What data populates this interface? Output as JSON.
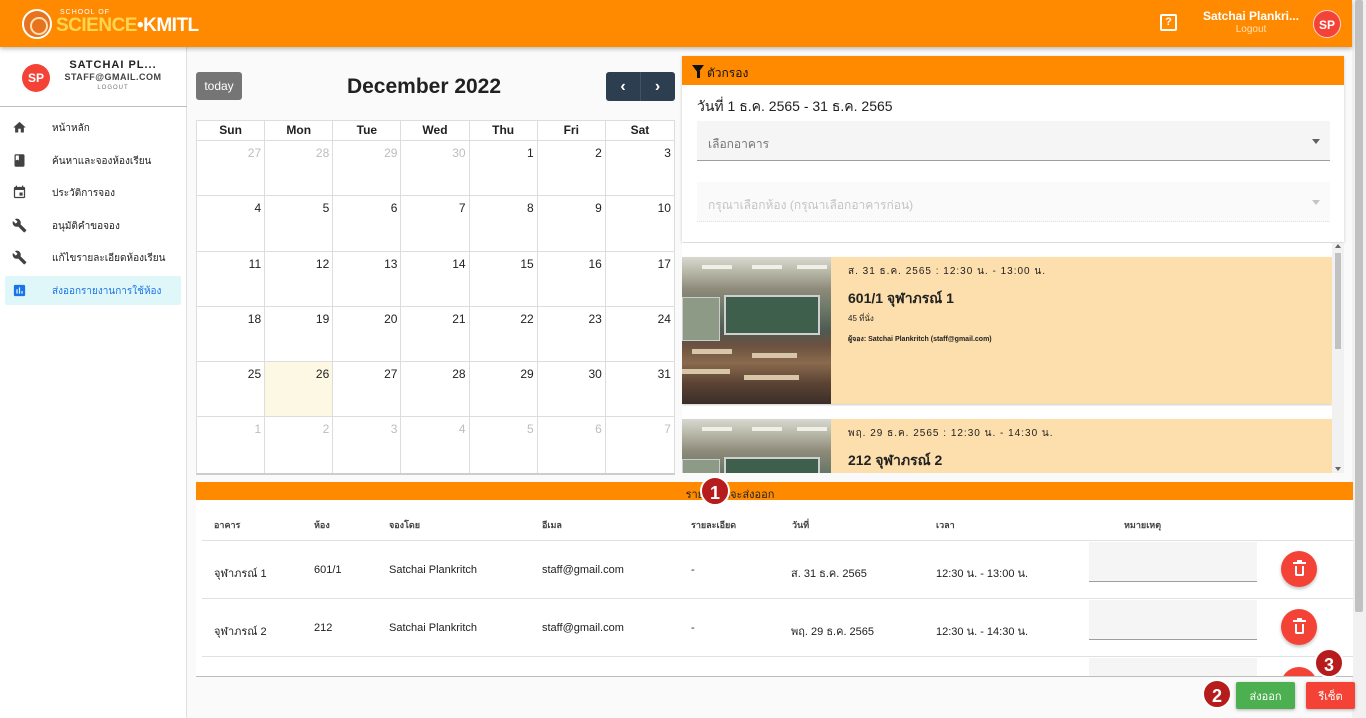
{
  "header": {
    "logo_small": "SCHOOL OF",
    "logo_sci": "SCIENCE",
    "logo_kmitl": "•KMITL",
    "help_icon": "help-question-icon",
    "user_name": "Satchai Plankri...",
    "logout_label": "Logout",
    "avatar_initials": "SP",
    "accent_color": "#ff8a00"
  },
  "sidebar": {
    "avatar_initials": "SP",
    "name": "SATCHAI PL...",
    "email": "STAFF@GMAIL.COM",
    "logout": "LOGOUT",
    "items": [
      {
        "label": "หน้าหลัก",
        "icon": "home-icon"
      },
      {
        "label": "ค้นหาและจองห้องเรียน",
        "icon": "book-icon"
      },
      {
        "label": "ประวัติการจอง",
        "icon": "calendar-icon"
      },
      {
        "label": "อนุมัติคำขอจอง",
        "icon": "wrench-icon"
      },
      {
        "label": "แก้ไขรายละเอียดห้องเรียน",
        "icon": "wrench-icon"
      },
      {
        "label": "ส่งออกรายงานการใช้ห้อง",
        "icon": "report-icon",
        "active": true
      }
    ]
  },
  "calendar": {
    "today_label": "today",
    "title": "December 2022",
    "prev_label": "‹",
    "next_label": "›",
    "weekdays": [
      "Sun",
      "Mon",
      "Tue",
      "Wed",
      "Thu",
      "Fri",
      "Sat"
    ],
    "weeks": [
      [
        {
          "d": "27",
          "o": true
        },
        {
          "d": "28",
          "o": true
        },
        {
          "d": "29",
          "o": true
        },
        {
          "d": "30",
          "o": true
        },
        {
          "d": "1"
        },
        {
          "d": "2"
        },
        {
          "d": "3"
        }
      ],
      [
        {
          "d": "4"
        },
        {
          "d": "5"
        },
        {
          "d": "6"
        },
        {
          "d": "7"
        },
        {
          "d": "8"
        },
        {
          "d": "9"
        },
        {
          "d": "10"
        }
      ],
      [
        {
          "d": "11"
        },
        {
          "d": "12"
        },
        {
          "d": "13"
        },
        {
          "d": "14"
        },
        {
          "d": "15"
        },
        {
          "d": "16"
        },
        {
          "d": "17"
        }
      ],
      [
        {
          "d": "18"
        },
        {
          "d": "19"
        },
        {
          "d": "20"
        },
        {
          "d": "21"
        },
        {
          "d": "22"
        },
        {
          "d": "23"
        },
        {
          "d": "24"
        }
      ],
      [
        {
          "d": "25"
        },
        {
          "d": "26",
          "t": true
        },
        {
          "d": "27"
        },
        {
          "d": "28"
        },
        {
          "d": "29"
        },
        {
          "d": "30"
        },
        {
          "d": "31"
        }
      ],
      [
        {
          "d": "1",
          "o": true
        },
        {
          "d": "2",
          "o": true
        },
        {
          "d": "3",
          "o": true
        },
        {
          "d": "4",
          "o": true
        },
        {
          "d": "5",
          "o": true
        },
        {
          "d": "6",
          "o": true
        },
        {
          "d": "7",
          "o": true
        }
      ]
    ]
  },
  "filter": {
    "title": "ตัวกรอง",
    "range": "วันที่ 1 ธ.ค. 2565 - 31 ธ.ค. 2565",
    "building_placeholder": "เลือกอาคาร",
    "room_placeholder": "กรุณาเลือกห้อง (กรุณาเลือกอาคารก่อน)"
  },
  "bookings": [
    {
      "when": "ส. 31 ธ.ค. 2565 : 12:30 น. - 13:00 น.",
      "room": "601/1 จุฬาภรณ์ 1",
      "seats": "45 ที่นั่ง",
      "by": "ผู้จอง: Satchai Plankritch (staff@gmail.com)"
    },
    {
      "when": "พฤ. 29 ธ.ค. 2565 : 12:30 น. - 14:30 น.",
      "room": "212 จุฬาภรณ์ 2",
      "seats": "",
      "by": ""
    }
  ],
  "export": {
    "title": "รายการที่จะส่งออก",
    "columns": [
      "อาคาร",
      "ห้อง",
      "จองโดย",
      "อีเมล",
      "รายละเอียด",
      "วันที่",
      "เวลา",
      "หมายเหตุ"
    ],
    "rows": [
      {
        "building": "จุฬาภรณ์ 1",
        "room": "601/1",
        "by": "Satchai Plankritch",
        "email": "staff@gmail.com",
        "detail": "-",
        "date": "ส. 31 ธ.ค. 2565",
        "time": "12:30 น. - 13:00 น.",
        "note": ""
      },
      {
        "building": "จุฬาภรณ์ 2",
        "room": "212",
        "by": "Satchai Plankritch",
        "email": "staff@gmail.com",
        "detail": "-",
        "date": "พฤ. 29 ธ.ค. 2565",
        "time": "12:30 น. - 14:30 น.",
        "note": ""
      }
    ],
    "export_label": "ส่งออก",
    "reset_label": "รีเซ็ต"
  },
  "badges": [
    "1",
    "2",
    "3"
  ]
}
